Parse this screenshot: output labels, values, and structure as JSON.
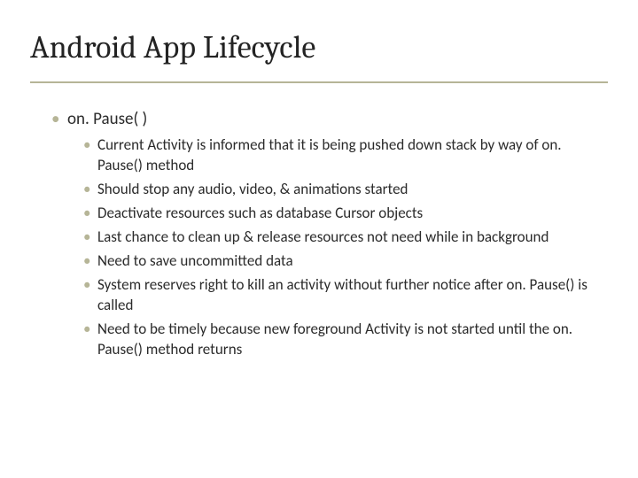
{
  "title": "Android App Lifecycle",
  "l1": {
    "item0": "on. Pause( )"
  },
  "l2": {
    "item0": "Current Activity is informed that it is being pushed down stack by way of on. Pause() method",
    "item1": "Should stop any audio, video, & animations started",
    "item2": "Deactivate resources such as database Cursor objects",
    "item3": "Last chance to clean up & release resources not need while in background",
    "item4": "Need to save uncommitted data",
    "item5": "System reserves right to kill an activity without further notice after on. Pause() is called",
    "item6": "Need to be timely because new foreground Activity is not started until the on. Pause() method returns"
  }
}
